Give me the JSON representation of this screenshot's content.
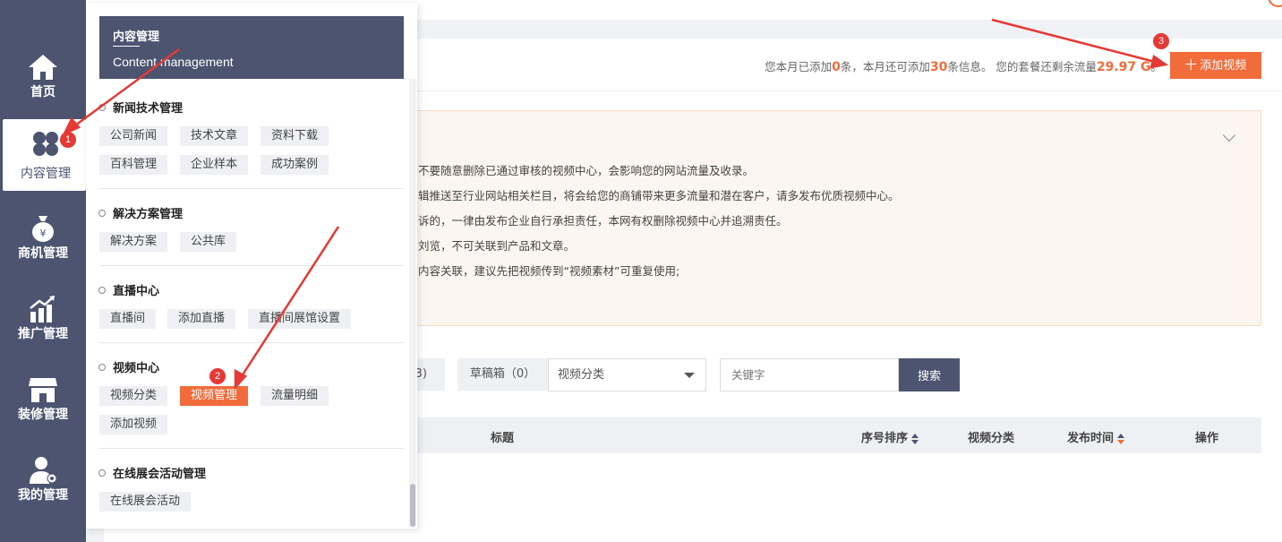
{
  "sidebar": {
    "items": [
      {
        "label": "首页",
        "icon": "home-icon"
      },
      {
        "label": "内容管理",
        "icon": "four-petal-icon"
      },
      {
        "label": "商机管理",
        "icon": "money-bag-icon"
      },
      {
        "label": "推广管理",
        "icon": "chart-up-icon"
      },
      {
        "label": "装修管理",
        "icon": "shop-icon"
      },
      {
        "label": "我的管理",
        "icon": "user-gear-icon"
      }
    ]
  },
  "panel": {
    "title_zh": "内容管理",
    "title_en": "Content management",
    "sections": [
      {
        "title": "新闻技术管理",
        "tags": [
          "公司新闻",
          "技术文章",
          "资料下载",
          "百科管理",
          "企业样本",
          "成功案例"
        ]
      },
      {
        "title": "解决方案管理",
        "tags": [
          "解决方案",
          "公共库"
        ]
      },
      {
        "title": "直播中心",
        "tags": [
          "直播间",
          "添加直播",
          "直播间展馆设置"
        ]
      },
      {
        "title": "视频中心",
        "tags": [
          "视频分类",
          "视频管理",
          "流量明细",
          "添加视频"
        ]
      },
      {
        "title": "在线展会活动管理",
        "tags": [
          "在线展会活动"
        ]
      }
    ]
  },
  "quota": {
    "p1": "您本月已添加",
    "added": "0",
    "p2": "条，本月还可添加",
    "remain": "30",
    "p3": "条信息。 您的套餐还剩余流量",
    "traffic": "29.97 G",
    "p4": "。"
  },
  "add_button": "十 添加视频",
  "notice_lines": [
    "不要随意删除已通过审核的视频中心，会影响您的网站流量及收录。",
    "辑推送至行业网站相关栏目，将会给您的商铺带来更多流量和潜在客户，请多发布优质视频中心。",
    "诉的，一律由发布企业自行承担责任，本网有权删除视频中心并追溯责任。",
    "刘览，不可关联到产品和文章。",
    "内容关联，建议先把视频传到“视频素材”可重复使用;"
  ],
  "filters": {
    "partial_count": "3)",
    "draft": "草稿箱（0）",
    "category_select": "视频分类",
    "keyword_placeholder": "关键字",
    "search": "搜索"
  },
  "table_headers": {
    "title": "标题",
    "order": "序号排序",
    "category": "视频分类",
    "publish_time": "发布时间",
    "actions": "操作"
  },
  "badges": [
    "1",
    "2",
    "3"
  ],
  "colors": {
    "accent": "#f26b3a",
    "sidebar": "#4d5470",
    "annotation": "#e53935"
  }
}
